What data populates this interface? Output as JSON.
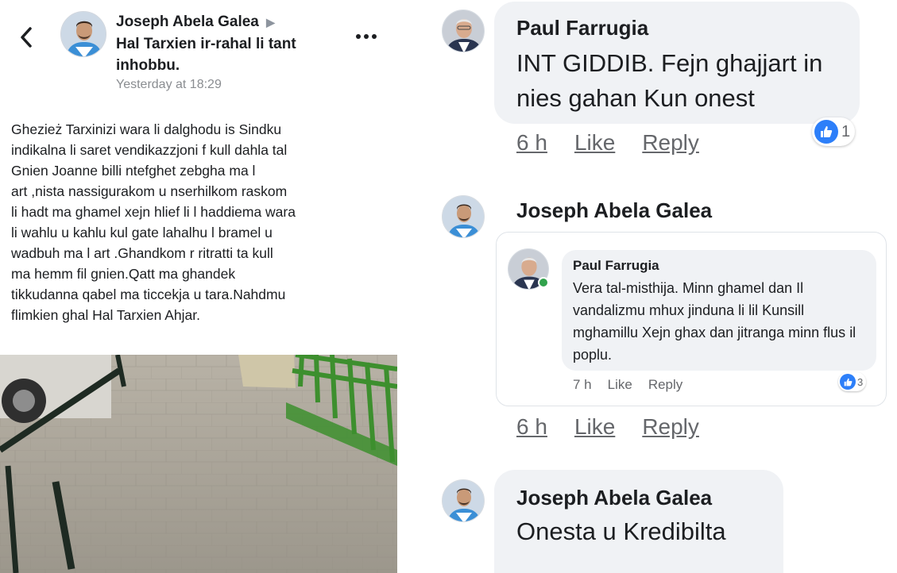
{
  "post": {
    "author": "Joseph Abela Galea",
    "group_arrow": "▶",
    "group": "Hal Tarxien ir-rahal li tant inhobbu.",
    "time": "Yesterday at 18:29",
    "body": "Ghezież Tarxinizi wara li dalghodu is Sindku\nindikalna li saret vendikazzjoni f kull dahla tal\nGnien  Joanne billi ntefghet zebgha ma l\nart ,nista nassigurakom u nserhilkom raskom\nli hadt ma ghamel xejn hlief li l haddiema wara\nli wahlu u kahlu kul gate lahalhu l bramel u\nwadbuh ma l art .Ghandkom r ritratti ta kull\nma hemm fil gnien.Qatt ma ghandek\ntikkudanna qabel ma ticcekja u tara.Nahdmu\nflimkien ghal Hal Tarxien Ahjar."
  },
  "comments": {
    "c1": {
      "name": "Paul Farrugia",
      "text": "INT GIDDIB. Fejn ghajjart in nies gahan Kun onest",
      "time": "6 h",
      "like": "Like",
      "reply": "Reply",
      "reactions": "1"
    },
    "c2": {
      "name": "Joseph Abela Galea",
      "time": "6 h",
      "like": "Like",
      "reply": "Reply",
      "quoted": {
        "name": "Paul Farrugia",
        "text": "Vera tal-misthija. Minn ghamel dan Il vandalizmu mhux jinduna li lil Kunsill mghamillu Xejn ghax dan jitranga minn flus il poplu.",
        "time": "7 h",
        "like": "Like",
        "reply": "Reply",
        "reactions": "3"
      }
    },
    "c3": {
      "name": "Joseph Abela Galea",
      "text": "Onesta u Kredibilta"
    }
  },
  "colors": {
    "bubble": "#f0f2f5",
    "like_blue": "#2d7ff9",
    "muted": "#65676b",
    "online": "#31a24c"
  },
  "icons": [
    "back-arrow-icon",
    "more-options-icon",
    "like-reaction-icon"
  ]
}
